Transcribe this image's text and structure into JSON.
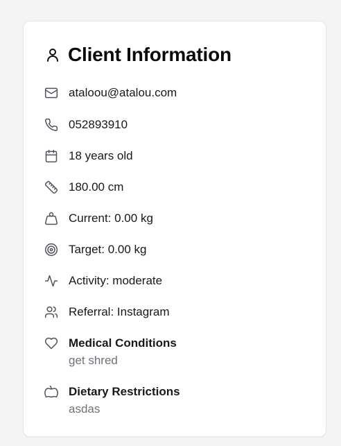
{
  "card": {
    "title": "Client Information",
    "title_icon": "user-icon",
    "items": [
      {
        "icon": "mail-icon",
        "text": "ataloou@atalou.com"
      },
      {
        "icon": "phone-icon",
        "text": "052893910"
      },
      {
        "icon": "calendar-icon",
        "text": "18 years old"
      },
      {
        "icon": "ruler-icon",
        "text": "180.00 cm"
      },
      {
        "icon": "weight-icon",
        "text": "Current: 0.00 kg"
      },
      {
        "icon": "target-icon",
        "text": "Target: 0.00 kg"
      },
      {
        "icon": "activity-icon",
        "text": "Activity: moderate"
      },
      {
        "icon": "users-icon",
        "text": "Referral: Instagram"
      }
    ],
    "medical": {
      "icon": "heart-icon",
      "label": "Medical Conditions",
      "value": "get shred"
    },
    "dietary": {
      "icon": "apple-icon",
      "label": "Dietary Restrictions",
      "value": "asdas"
    }
  },
  "colors": {
    "icon": "#52525b",
    "text": "#18181b",
    "muted": "#71717a",
    "background": "#f4f4f5",
    "card": "#ffffff"
  }
}
